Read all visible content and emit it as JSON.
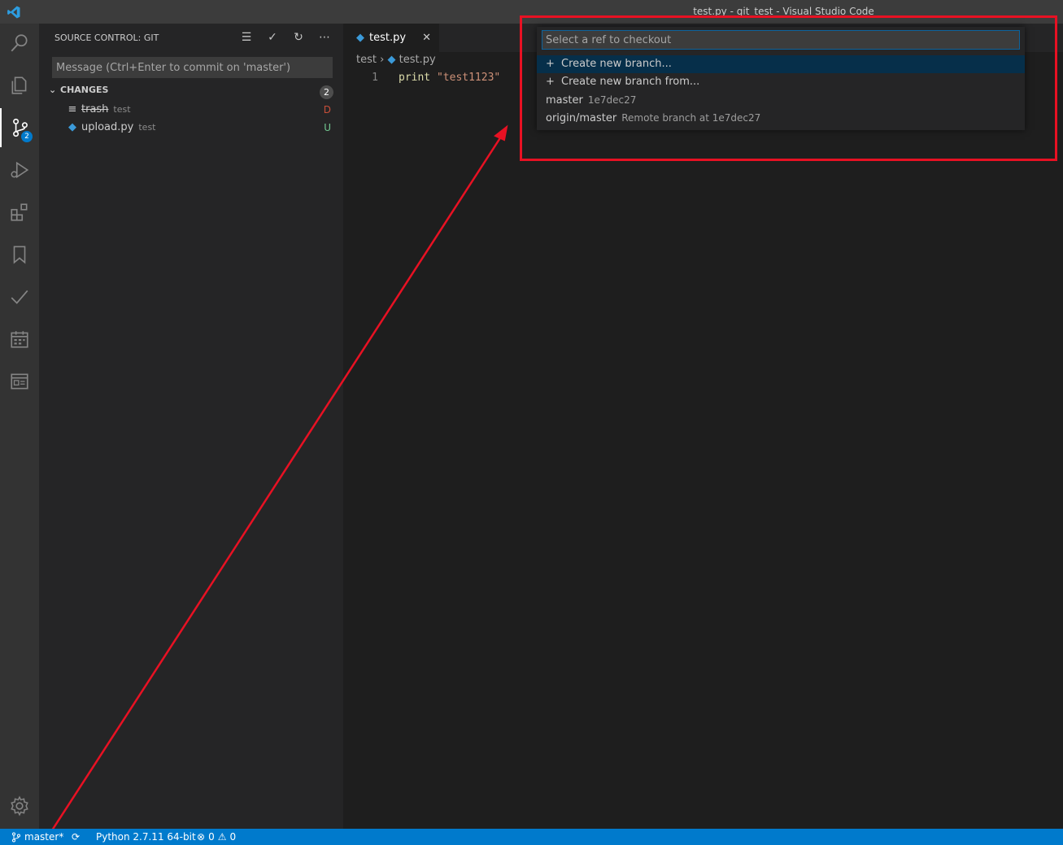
{
  "window": {
    "title": "test.py - git_test - Visual Studio Code"
  },
  "activity": {
    "scm_badge": "2"
  },
  "sidebar": {
    "header": "SOURCE CONTROL: GIT",
    "commit_placeholder": "Message (Ctrl+Enter to commit on 'master')",
    "section": {
      "label": "CHANGES",
      "count": "2"
    },
    "files": [
      {
        "name": "trash",
        "dir": "test",
        "status": "D",
        "status_color": "#c74e39"
      },
      {
        "name": "upload.py",
        "dir": "test",
        "status": "U",
        "status_color": "#73c991"
      }
    ]
  },
  "editor": {
    "tab": {
      "label": "test.py"
    },
    "breadcrumb": {
      "folder": "test",
      "file": "test.py"
    },
    "lines": [
      {
        "num": "1",
        "keyword": "print",
        "string": "\"test1123\""
      }
    ]
  },
  "quickpick": {
    "placeholder": "Select a ref to checkout",
    "items": [
      {
        "label": "Create new branch...",
        "desc": ""
      },
      {
        "label": "Create new branch from...",
        "desc": ""
      },
      {
        "label": "master",
        "desc": "1e7dec27"
      },
      {
        "label": "origin/master",
        "desc": "Remote branch at 1e7dec27"
      }
    ]
  },
  "statusbar": {
    "branch": "master*",
    "python": "Python 2.7.11 64-bit",
    "errors": "0",
    "warnings": "0"
  },
  "colors": {
    "accent": "#007acc",
    "annotation": "#e81123"
  }
}
